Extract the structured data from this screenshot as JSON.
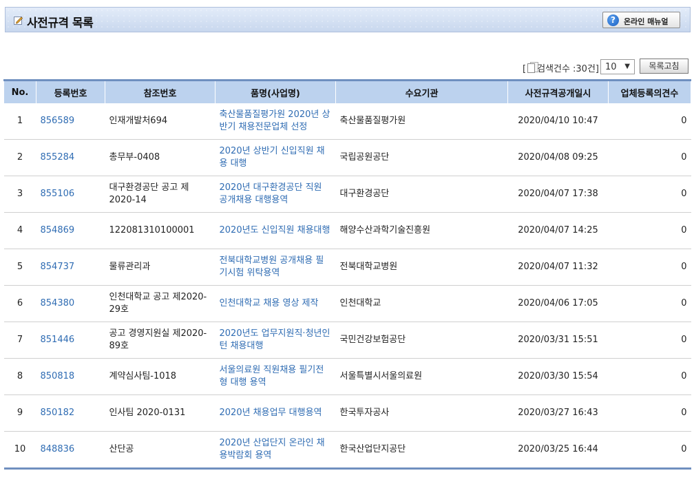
{
  "header": {
    "title": "사전규격 목록",
    "manual_label": "온라인 매뉴얼"
  },
  "toolbar": {
    "count_text": "[",
    "count_label": "검색건수 :30건]",
    "page_size": "10",
    "refresh_label": "목록고침"
  },
  "table": {
    "columns": [
      "No.",
      "등록번호",
      "참조번호",
      "품명(사업명)",
      "수요기관",
      "사전규격공개일시",
      "업체등록의견수"
    ],
    "rows": [
      {
        "no": "1",
        "reg": "856589",
        "ref": "인재개발처694",
        "name": "축산물품질평가원 2020년 상반기 채용전문업체 선정",
        "org": "축산물품질평가원",
        "date": "2020/04/10 10:47",
        "cnt": "0"
      },
      {
        "no": "2",
        "reg": "855284",
        "ref": "총무부-0408",
        "name": "2020년 상반기 신입직원 채용 대행",
        "org": "국립공원공단",
        "date": "2020/04/08 09:25",
        "cnt": "0"
      },
      {
        "no": "3",
        "reg": "855106",
        "ref": "대구환경공단 공고 제2020-14",
        "name": "2020년 대구환경공단 직원 공개채용 대행용역",
        "org": "대구환경공단",
        "date": "2020/04/07 17:38",
        "cnt": "0"
      },
      {
        "no": "4",
        "reg": "854869",
        "ref": "122081310100001",
        "name": "2020년도 신입직원 채용대행",
        "org": "해양수산과학기술진흥원",
        "date": "2020/04/07 14:25",
        "cnt": "0"
      },
      {
        "no": "5",
        "reg": "854737",
        "ref": "물류관리과",
        "name": "전북대학교병원 공개채용 필기시험 위탁용역",
        "org": "전북대학교병원",
        "date": "2020/04/07 11:32",
        "cnt": "0"
      },
      {
        "no": "6",
        "reg": "854380",
        "ref": "인천대학교 공고 제2020-29호",
        "name": "인천대학교 채용 영상 제작",
        "org": "인천대학교",
        "date": "2020/04/06 17:05",
        "cnt": "0"
      },
      {
        "no": "7",
        "reg": "851446",
        "ref": "공고 경영지원실 제2020-89호",
        "name": "2020년도 업무지원직·청년인턴 채용대행",
        "org": "국민건강보험공단",
        "date": "2020/03/31 15:51",
        "cnt": "0"
      },
      {
        "no": "8",
        "reg": "850818",
        "ref": "계약심사팀-1018",
        "name": "서울의료원 직원채용 필기전형 대행 용역",
        "org": "서울특별시서울의료원",
        "date": "2020/03/30 15:54",
        "cnt": "0"
      },
      {
        "no": "9",
        "reg": "850182",
        "ref": "인사팀 2020-0131",
        "name": "2020년 채용업무 대행용역",
        "org": "한국투자공사",
        "date": "2020/03/27 16:43",
        "cnt": "0"
      },
      {
        "no": "10",
        "reg": "848836",
        "ref": "산단공",
        "name": "2020년 산업단지 온라인 채용박람회 용역",
        "org": "한국산업단지공단",
        "date": "2020/03/25 16:44",
        "cnt": "0"
      }
    ]
  }
}
